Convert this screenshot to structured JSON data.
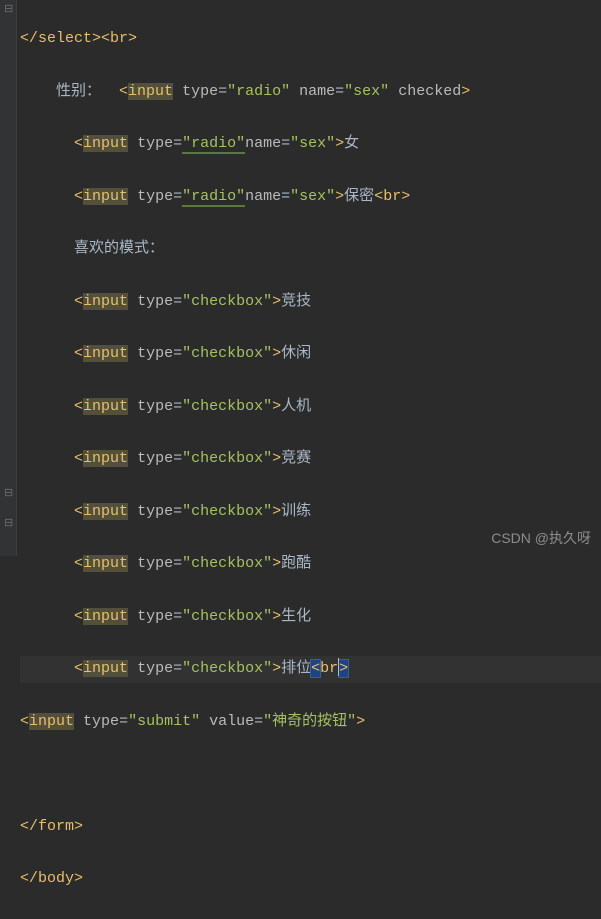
{
  "lines": {
    "l1": {
      "close_select": "</select>",
      "br": "<br>"
    },
    "l2": {
      "text1": "性别：  ",
      "open": "<",
      "tag": "input",
      "a1n": "type",
      "a1v": "\"radio\"",
      "a2n": "name",
      "a2v": "\"sex\"",
      "a3n": "checked",
      "close": ">"
    },
    "l3": {
      "open": "<",
      "tag": "input",
      "a1n": "type",
      "a1v": "\"radio\"",
      "a2n": "name",
      "a2v": "\"sex\"",
      "close": ">",
      "txt": "女"
    },
    "l4": {
      "open": "<",
      "tag": "input",
      "a1n": "type",
      "a1v": "\"radio\"",
      "a2n": "name",
      "a2v": "\"sex\"",
      "close": ">",
      "txt": "保密",
      "br": "<br>"
    },
    "l5": {
      "txt": "喜欢的模式："
    },
    "l6": {
      "open": "<",
      "tag": "input",
      "a1n": "type",
      "a1v": "\"checkbox\"",
      "close": ">",
      "txt": "竞技"
    },
    "l7": {
      "open": "<",
      "tag": "input",
      "a1n": "type",
      "a1v": "\"checkbox\"",
      "close": ">",
      "txt": "休闲"
    },
    "l8": {
      "open": "<",
      "tag": "input",
      "a1n": "type",
      "a1v": "\"checkbox\"",
      "close": ">",
      "txt": "人机"
    },
    "l9": {
      "open": "<",
      "tag": "input",
      "a1n": "type",
      "a1v": "\"checkbox\"",
      "close": ">",
      "txt": "竞赛"
    },
    "l10": {
      "open": "<",
      "tag": "input",
      "a1n": "type",
      "a1v": "\"checkbox\"",
      "close": ">",
      "txt": "训练"
    },
    "l11": {
      "open": "<",
      "tag": "input",
      "a1n": "type",
      "a1v": "\"checkbox\"",
      "close": ">",
      "txt": "跑酷"
    },
    "l12": {
      "open": "<",
      "tag": "input",
      "a1n": "type",
      "a1v": "\"checkbox\"",
      "close": ">",
      "txt": "生化"
    },
    "l13": {
      "open": "<",
      "tag": "input",
      "a1n": "type",
      "a1v": "\"checkbox\"",
      "close": ">",
      "txt": "排位",
      "br_open": "<",
      "br_tag": "br",
      "br_close": ">"
    },
    "l14": {
      "open": "<",
      "tag": "input",
      "a1n": "type",
      "a1v": "\"submit\"",
      "a2n": "value",
      "a2v": "\"神奇的按钮\"",
      "close": ">"
    },
    "l15": "",
    "l16": {
      "tag": "</form>"
    },
    "l17": {
      "tag": "</body>"
    }
  },
  "watermark": "CSDN @执久呀"
}
